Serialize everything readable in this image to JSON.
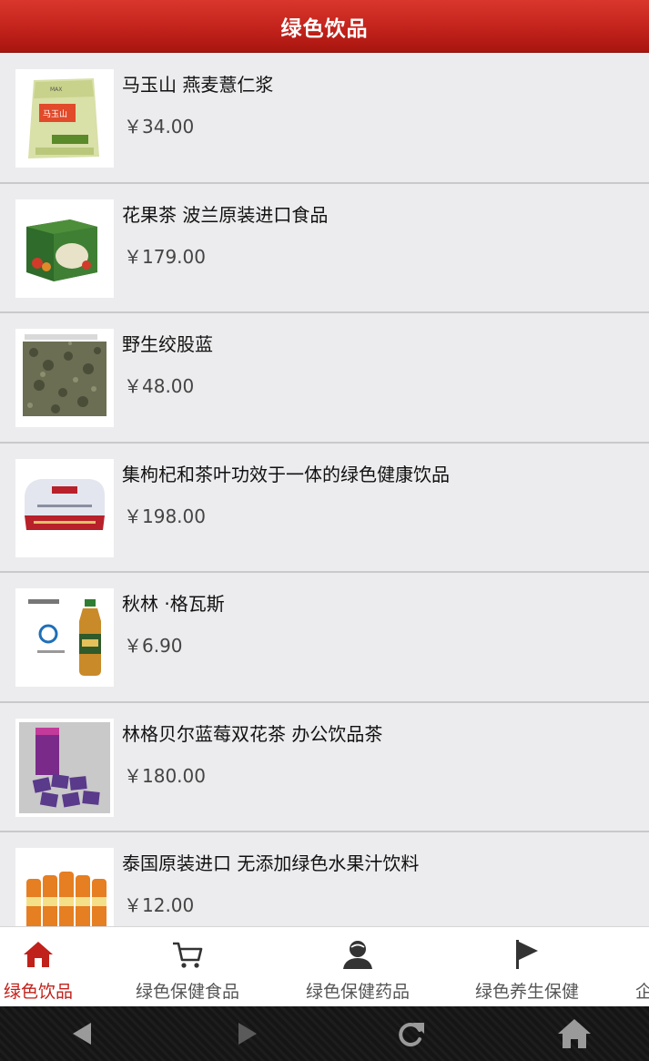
{
  "header": {
    "title": "绿色饮品"
  },
  "products": [
    {
      "title": "马玉山 燕麦薏仁浆",
      "price": "￥34.00",
      "image": "oatmeal-drink-package"
    },
    {
      "title": "花果茶 波兰原装进口食品",
      "price": "￥179.00",
      "image": "fruit-tea-box"
    },
    {
      "title": "野生绞股蓝",
      "price": "￥48.00",
      "image": "gynostemma-tea-leaves"
    },
    {
      "title": "集枸杞和茶叶功效于一体的绿色健康饮品",
      "price": "￥198.00",
      "image": "tea-tin-box"
    },
    {
      "title": "秋林 ·格瓦斯",
      "price": "￥6.90",
      "image": "kvass-bottle"
    },
    {
      "title": "林格贝尔蓝莓双花茶 办公饮品茶",
      "price": "￥180.00",
      "image": "blueberry-tea-packets"
    },
    {
      "title": "泰国原装进口 无添加绿色水果汁饮料",
      "price": "￥12.00",
      "image": "juice-bottles"
    }
  ],
  "tabbar": {
    "tabs": [
      {
        "label": "绿色饮品",
        "icon": "home-icon",
        "active": true
      },
      {
        "label": "绿色保健食品",
        "icon": "cart-icon",
        "active": false
      },
      {
        "label": "绿色保健药品",
        "icon": "person-icon",
        "active": false
      },
      {
        "label": "绿色养生保健",
        "icon": "flag-icon",
        "active": false
      },
      {
        "label": "企",
        "icon": "",
        "active": false
      }
    ]
  },
  "system_nav": {
    "buttons": [
      "back-icon",
      "forward-icon",
      "refresh-icon",
      "home-icon"
    ]
  },
  "colors": {
    "accent": "#c0211a",
    "header": "#c9261d",
    "list_bg": "#ececee"
  }
}
